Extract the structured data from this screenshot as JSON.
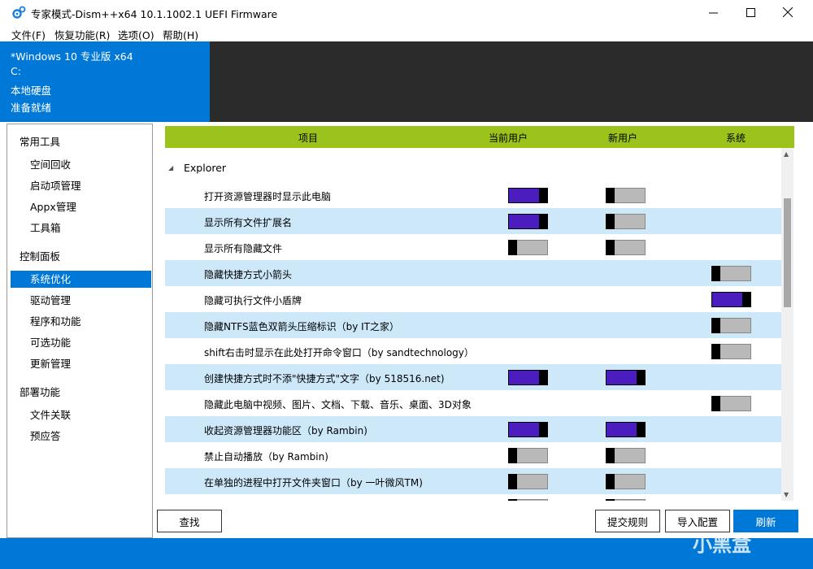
{
  "window": {
    "title": "专家模式-Dism++x64 10.1.1002.1 UEFI Firmware"
  },
  "menu": [
    "文件(F)",
    "恢复功能(R)",
    "选项(O)",
    "帮助(H)"
  ],
  "info_panel": {
    "os": "*Windows 10 专业版 x64",
    "drive": "C:",
    "disk": "本地硬盘",
    "status": "准备就绪"
  },
  "sidebar": {
    "sections": [
      {
        "title": "常用工具",
        "items": [
          "空间回收",
          "启动项管理",
          "Appx管理",
          "工具箱"
        ]
      },
      {
        "title": "控制面板",
        "items": [
          "系统优化",
          "驱动管理",
          "程序和功能",
          "可选功能",
          "更新管理"
        ]
      },
      {
        "title": "部署功能",
        "items": [
          "文件关联",
          "预应答"
        ]
      }
    ],
    "selected": "系统优化"
  },
  "table": {
    "headers": [
      "项目",
      "当前用户",
      "新用户",
      "系统"
    ],
    "group": "Explorer",
    "rows": [
      {
        "label": "打开资源管理器时显示此电脑",
        "current": "on",
        "new": "off",
        "system": null
      },
      {
        "label": "显示所有文件扩展名",
        "current": "on",
        "new": "off",
        "system": null
      },
      {
        "label": "显示所有隐藏文件",
        "current": "off",
        "new": "off",
        "system": null
      },
      {
        "label": "隐藏快捷方式小箭头",
        "current": null,
        "new": null,
        "system": "off"
      },
      {
        "label": "隐藏可执行文件小盾牌",
        "current": null,
        "new": null,
        "system": "on"
      },
      {
        "label": "隐藏NTFS蓝色双箭头压缩标识（by IT之家）",
        "current": null,
        "new": null,
        "system": "off"
      },
      {
        "label": "shift右击时显示在此处打开命令窗口（by sandtechnology）",
        "current": null,
        "new": null,
        "system": "off"
      },
      {
        "label": "创建快捷方式时不添\"快捷方式\"文字（by 518516.net)",
        "current": "on",
        "new": "on",
        "system": null
      },
      {
        "label": "隐藏此电脑中视频、图片、文档、下载、音乐、桌面、3D对象",
        "current": null,
        "new": null,
        "system": "off"
      },
      {
        "label": "收起资源管理器功能区（by Rambin)",
        "current": "on",
        "new": "on",
        "system": null
      },
      {
        "label": "禁止自动播放（by Rambin)",
        "current": "off",
        "new": "off",
        "system": null
      },
      {
        "label": "在单独的进程中打开文件夹窗口（by 一叶微风TM)",
        "current": "off",
        "new": "off",
        "system": null
      }
    ]
  },
  "buttons": {
    "find": "查找",
    "submit_rule": "提交规则",
    "import_config": "导入配置",
    "refresh": "刷新"
  },
  "watermark": "小黑盒",
  "colors": {
    "accent": "#0078d7",
    "header_green": "#9bc31c",
    "toggle_on": "#4b1dbf",
    "row_alt": "#cce8f9"
  }
}
